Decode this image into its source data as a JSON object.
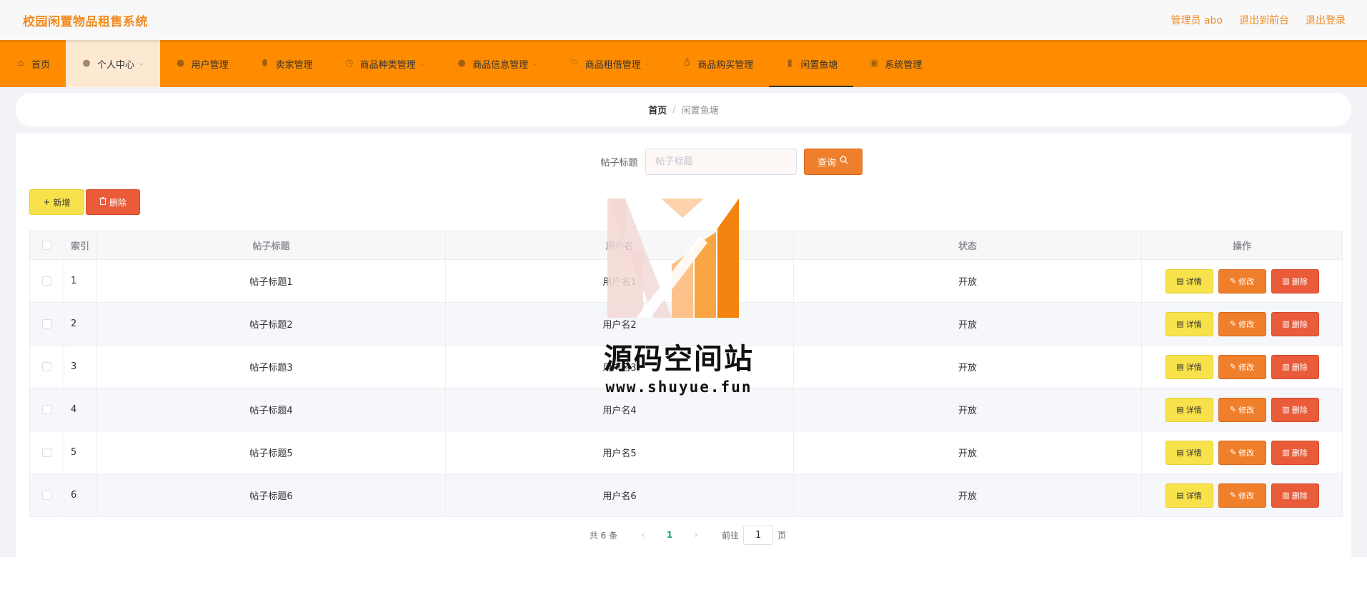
{
  "header": {
    "app_title": "校园闲置物品租售系统",
    "admin_label": "管理员 abo",
    "exit_frontend": "退出到前台",
    "logout": "退出登录"
  },
  "nav": {
    "items": [
      {
        "label": "首页",
        "icon": "home-icon"
      },
      {
        "label": "个人中心",
        "icon": "user-icon"
      },
      {
        "label": "用户管理",
        "icon": "user-icon"
      },
      {
        "label": "卖家管理",
        "icon": "location-icon"
      },
      {
        "label": "商品种类管理",
        "icon": "clock-icon"
      },
      {
        "label": "商品信息管理",
        "icon": "user-icon"
      },
      {
        "label": "商品租借管理",
        "icon": "flag-icon"
      },
      {
        "label": "商品购买管理",
        "icon": "mic-icon"
      },
      {
        "label": "闲置鱼塘",
        "icon": "chart-icon"
      },
      {
        "label": "系统管理",
        "icon": "briefcase-icon"
      }
    ]
  },
  "breadcrumb": {
    "home": "首页",
    "separator": "/",
    "current": "闲置鱼塘"
  },
  "search": {
    "label": "帖子标题",
    "placeholder": "帖子标题",
    "button": "查询"
  },
  "actions": {
    "add": "新增",
    "delete": "删除"
  },
  "table": {
    "headers": {
      "index": "索引",
      "title": "帖子标题",
      "user": "用户名",
      "status": "状态",
      "ops": "操作"
    },
    "rows": [
      {
        "index": "1",
        "title": "帖子标题1",
        "user": "用户名1",
        "status": "开放"
      },
      {
        "index": "2",
        "title": "帖子标题2",
        "user": "用户名2",
        "status": "开放"
      },
      {
        "index": "3",
        "title": "帖子标题3",
        "user": "用户名3",
        "status": "开放"
      },
      {
        "index": "4",
        "title": "帖子标题4",
        "user": "用户名4",
        "status": "开放"
      },
      {
        "index": "5",
        "title": "帖子标题5",
        "user": "用户名5",
        "status": "开放"
      },
      {
        "index": "6",
        "title": "帖子标题6",
        "user": "用户名6",
        "status": "开放"
      }
    ],
    "row_ops": {
      "detail": "详情",
      "edit": "修改",
      "delete": "删除"
    }
  },
  "pagination": {
    "total": "共 6 条",
    "current_page": "1",
    "goto_prefix": "前往",
    "goto_value": "1",
    "goto_suffix": "页"
  },
  "watermark": {
    "title": "源码空间站",
    "url": "www.shuyue.fun"
  },
  "colors": {
    "nav_bg": "#ff8c00",
    "accent": "#f28a1e",
    "btn_yellow": "#f7e24b",
    "btn_orange": "#f07f2c",
    "btn_red": "#ea5b3a"
  }
}
